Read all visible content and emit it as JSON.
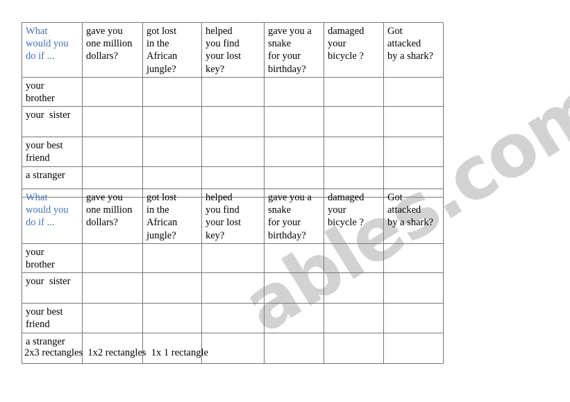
{
  "document": {
    "type": "esl-worksheet",
    "background_color": "#ffffff",
    "text_color": "#000000",
    "accent_color": "#4472b4",
    "border_color": "#767676"
  },
  "watermark": {
    "text": "ables.com",
    "color": "#d2d2d2"
  },
  "table": {
    "headers": [
      "What\nwould you\ndo if ...",
      "gave you\none million\ndollars?",
      "got lost\nin the\nAfrican\njungle?",
      "helped\nyou find\nyour lost\nkey?",
      "gave you a\nsnake\nfor your\nbirthday?",
      "damaged\nyour\nbicycle ?",
      "Got\nattacked\nby a shark?"
    ],
    "row_labels": [
      "your\nbrother",
      "your  sister",
      "your best\nfriend",
      "a stranger"
    ],
    "cells": [
      [
        "",
        "",
        "",
        "",
        "",
        ""
      ],
      [
        "",
        "",
        "",
        "",
        "",
        ""
      ],
      [
        "",
        "",
        "",
        "",
        "",
        ""
      ],
      [
        "",
        "",
        "",
        "",
        "",
        ""
      ]
    ]
  },
  "caption": {
    "text": "2x3 rectangles  1x2 rectangles  1x 1 rectangle"
  }
}
